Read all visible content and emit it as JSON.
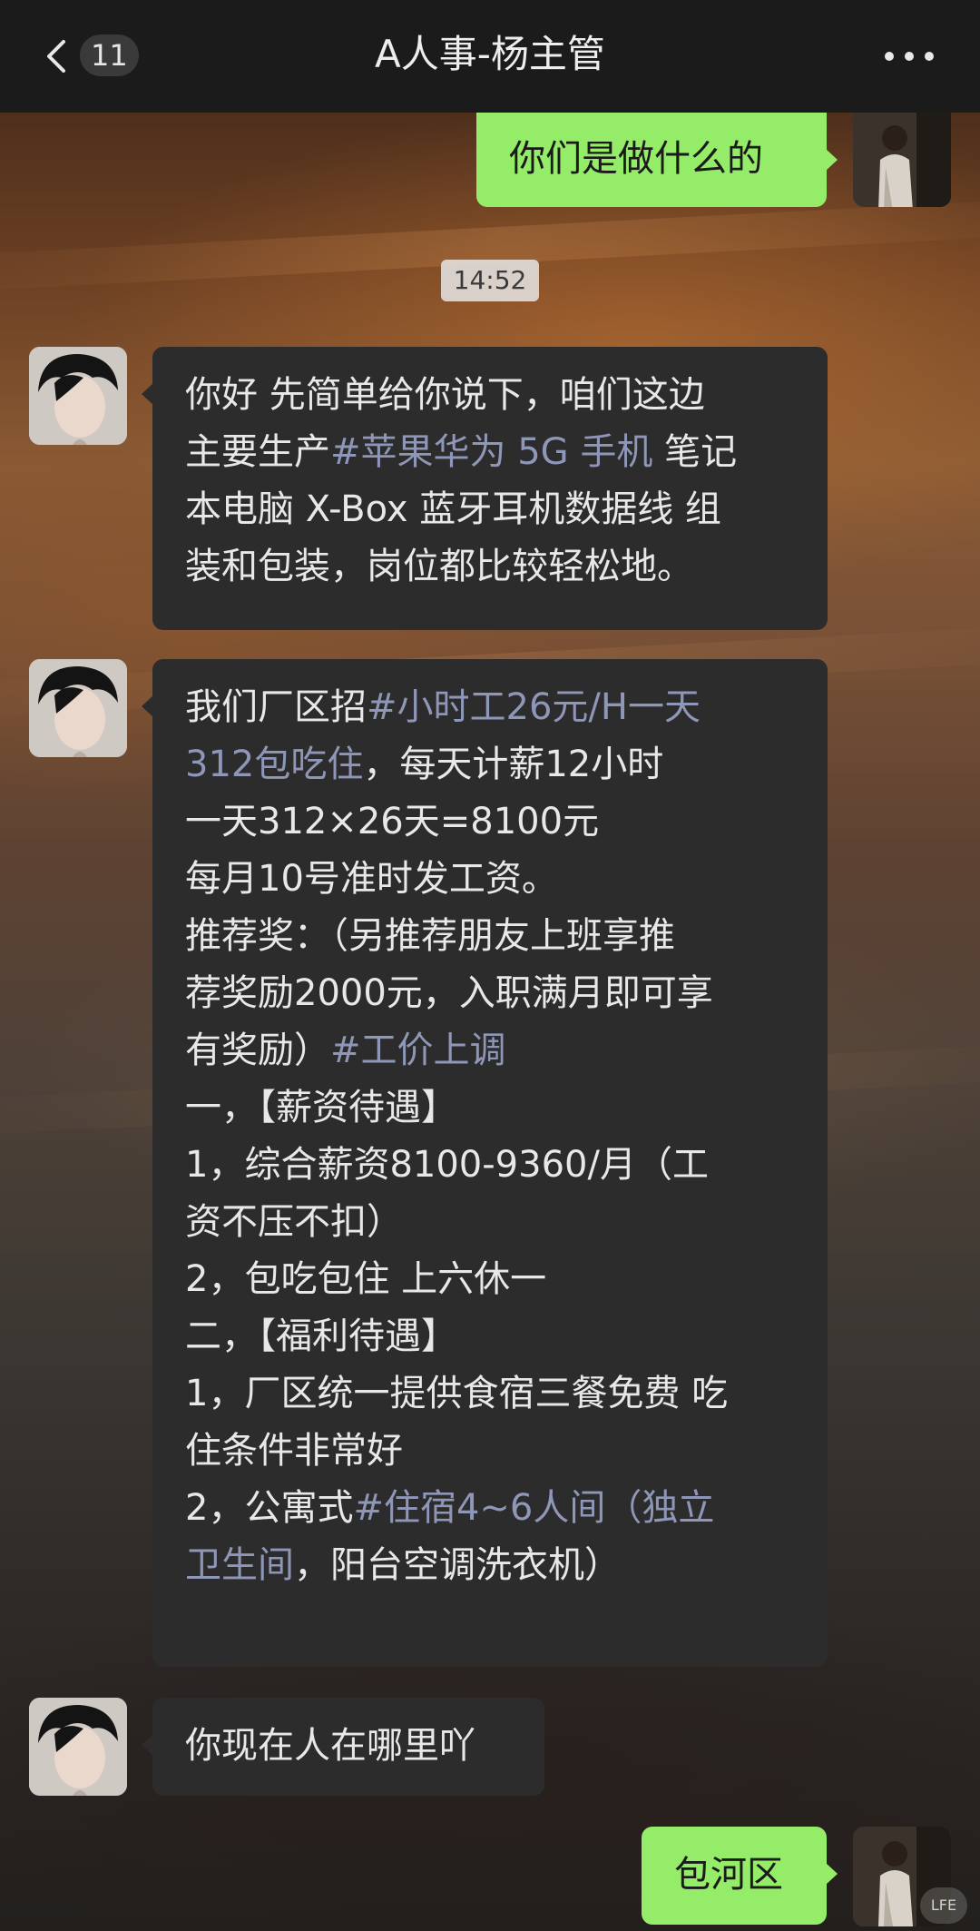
{
  "header": {
    "back_count": "11",
    "title": "A人事-杨主管"
  },
  "timestamp": "14:52",
  "messages": [
    {
      "sender": "self",
      "text": "你们是做什么的"
    },
    {
      "sender": "other",
      "lines": [
        [
          {
            "t": "你好 先简单给你说下，咱们这边"
          }
        ],
        [
          {
            "t": "主要生产"
          },
          {
            "t": "#苹果华为 5G 手机",
            "hl": true
          },
          {
            "t": " 笔记"
          }
        ],
        [
          {
            "t": "本电脑 X-Box 蓝牙耳机数据线 组"
          }
        ],
        [
          {
            "t": "装和包装，岗位都比较轻松地。"
          }
        ]
      ]
    },
    {
      "sender": "other",
      "lines": [
        [
          {
            "t": " 我们厂区招"
          },
          {
            "t": "#小时工26元/H一天",
            "hl": true
          }
        ],
        [
          {
            "t": "312包吃住",
            "hl": true
          },
          {
            "t": "，每天计薪12小时"
          }
        ],
        [
          {
            "t": "一天312×26天=8100元"
          }
        ],
        [
          {
            "t": "每月10号准时发工资。"
          }
        ],
        [
          {
            "t": "推荐奖：（另推荐朋友上班享推"
          }
        ],
        [
          {
            "t": "荐奖励2000元，入职满月即可享"
          }
        ],
        [
          {
            "t": "有奖励）"
          },
          {
            "t": "#工价上调",
            "hl": true
          }
        ],
        [
          {
            "t": "一，【薪资待遇】"
          }
        ],
        [
          {
            "t": "1，综合薪资8100-9360/月（工"
          }
        ],
        [
          {
            "t": "资不压不扣）"
          }
        ],
        [
          {
            "t": "2，包吃包住 上六休一"
          }
        ],
        [
          {
            "t": "二，【福利待遇】"
          }
        ],
        [
          {
            "t": "1，厂区统一提供食宿三餐免费 吃"
          }
        ],
        [
          {
            "t": "住条件非常好"
          }
        ],
        [
          {
            "t": "2，公寓式"
          },
          {
            "t": "#住宿4~6人间（独立",
            "hl": true
          }
        ],
        [
          {
            "t": "卫生间",
            "hl": true
          },
          {
            "t": "，阳台空调洗衣机）"
          }
        ]
      ]
    },
    {
      "sender": "other",
      "text": "你现在人在哪里吖"
    },
    {
      "sender": "self",
      "text": "包河区"
    }
  ],
  "watermark": "LFE",
  "colors": {
    "self_bubble": "#95ec69",
    "other_bubble": "#2c2c2c",
    "hashtag": "#8f97b8",
    "topbar": "#1b1b1b"
  },
  "icons": [
    "back-chevron-icon",
    "more-dots-icon"
  ]
}
